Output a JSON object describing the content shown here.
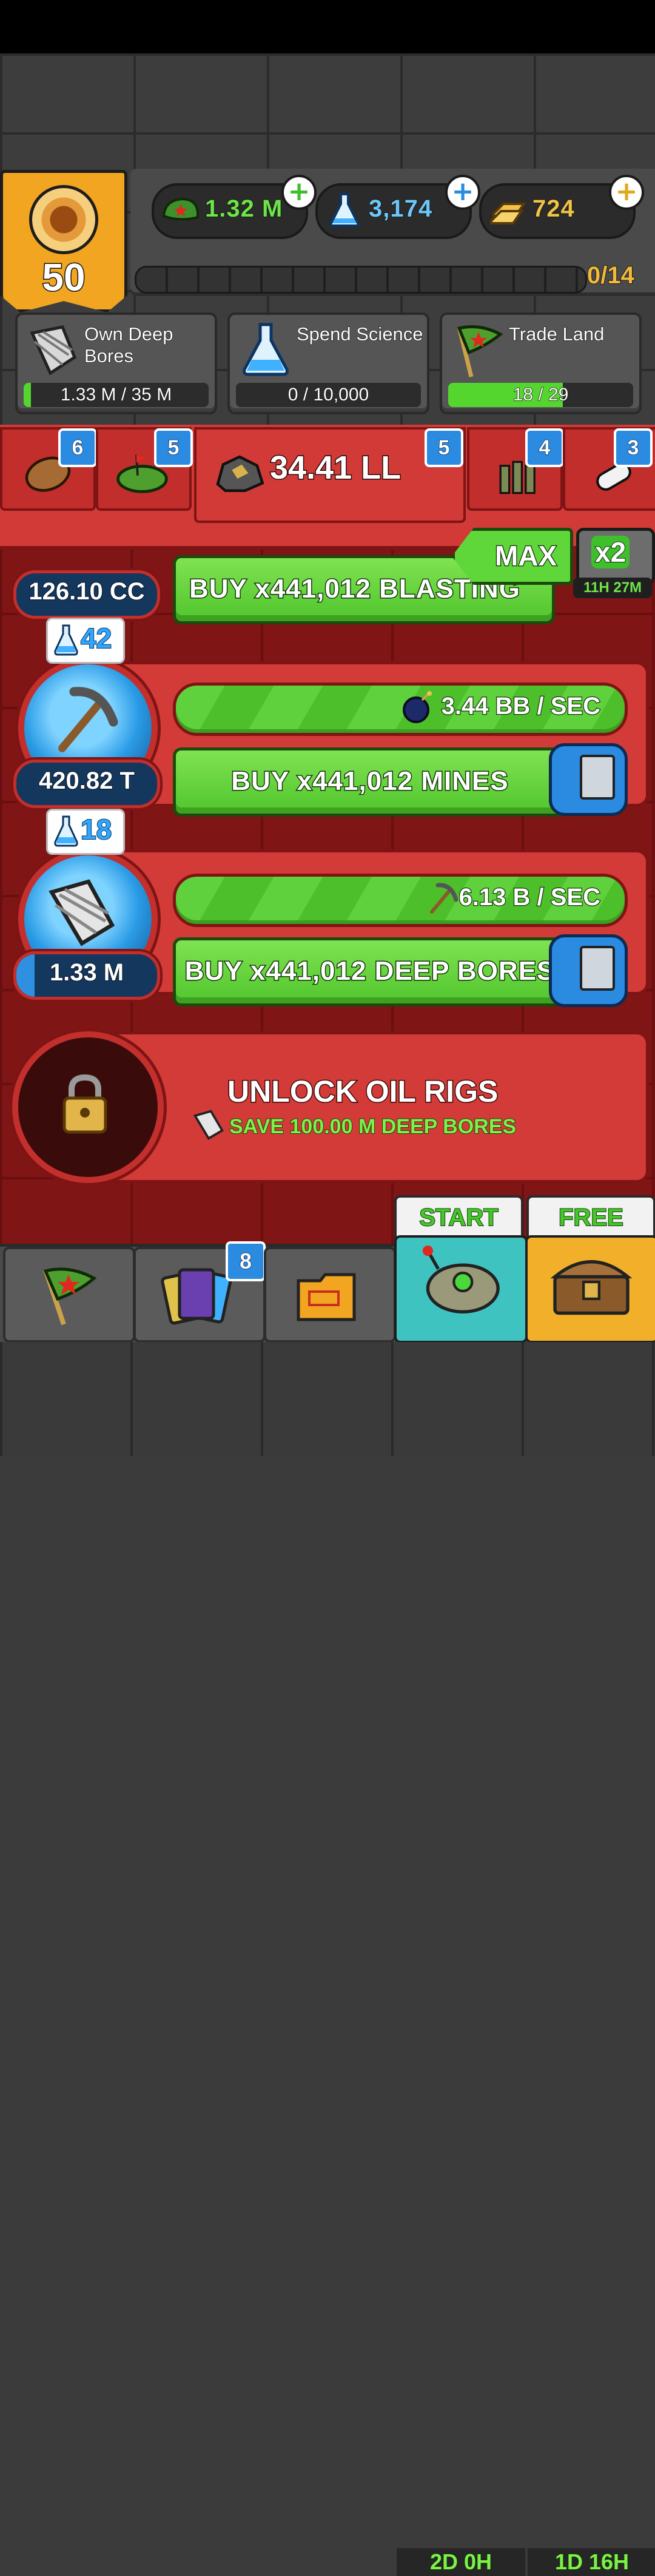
{
  "player": {
    "rank": "50"
  },
  "currencies": [
    {
      "name": "cash",
      "value": "1.32 M",
      "color": "#6fe349"
    },
    {
      "name": "science",
      "value": "3,174",
      "color": "#6fc6ff"
    },
    {
      "name": "gold",
      "value": "724",
      "color": "#f2c14a"
    }
  ],
  "rank_progress": {
    "label": "0/14",
    "fraction": 0.0
  },
  "tasks": [
    {
      "icon": "drill-bore-icon",
      "title": "Own Deep Bores",
      "progress_label": "1.33 M / 35 M",
      "fraction": 0.04
    },
    {
      "icon": "science-flask-icon",
      "title": "Spend Science",
      "progress_label": "0 / 10,000",
      "fraction": 0.0
    },
    {
      "icon": "red-star-flag-icon",
      "title": "Trade Land",
      "progress_label": "18 / 29",
      "fraction": 0.62
    }
  ],
  "resources": {
    "main_value": "34.41 LL",
    "tabs": [
      {
        "icon": "potato-icon",
        "badge": "6"
      },
      {
        "icon": "land-plot-icon",
        "badge": "5"
      },
      {
        "icon": "coal-ore-icon",
        "badge": "5"
      },
      {
        "icon": "bullets-icon",
        "badge": "4"
      },
      {
        "icon": "pill-icon",
        "badge": "3"
      }
    ]
  },
  "multiplier": {
    "max_label": "MAX",
    "boost_label": "x2",
    "boost_timer": "11H 27M"
  },
  "generators": [
    {
      "name": "blasting",
      "owned": "126.10 CC",
      "buy_label": "BUY x441,012 BLASTING"
    },
    {
      "name": "mines",
      "science_cost": "42",
      "owned": "420.82 T",
      "owned_fraction": 0.0,
      "rate": "3.44 BB / SEC",
      "rate_icon": "bomb-icon",
      "buy_label": "BUY x441,012 MINES"
    },
    {
      "name": "deep-bores",
      "science_cost": "18",
      "owned": "1.33 M",
      "owned_fraction": 0.13,
      "rate": "6.13 B / SEC",
      "rate_icon": "pickaxe-icon",
      "buy_label": "BUY x441,012 DEEP BORES"
    }
  ],
  "unlock": {
    "title": "UNLOCK OIL RIGS",
    "subtitle": "SAVE 100.00 M DEEP BORES"
  },
  "nav": {
    "items": [
      {
        "icon": "red-star-flag-icon"
      },
      {
        "icon": "cards-icon",
        "badge": "8"
      },
      {
        "icon": "folder-icon"
      }
    ],
    "events": [
      {
        "label": "START",
        "timer": "2D 0H",
        "icon": "drone-icon"
      },
      {
        "label": "FREE",
        "timer": "1D 16H",
        "icon": "treasure-chest-icon"
      }
    ]
  }
}
